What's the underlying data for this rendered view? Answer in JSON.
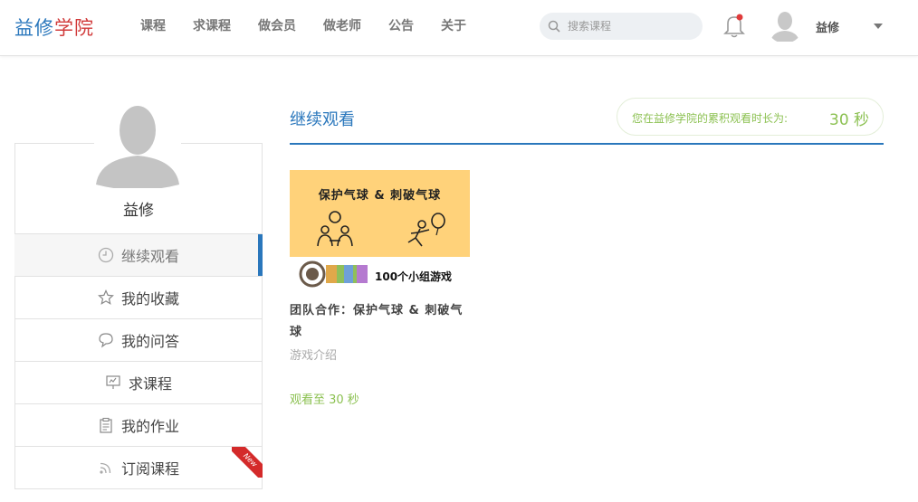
{
  "logo": {
    "part1": "益修",
    "part2": "学院"
  },
  "nav": [
    "课程",
    "求课程",
    "做会员",
    "做老师",
    "公告",
    "关于"
  ],
  "search": {
    "placeholder": "搜索课程"
  },
  "user": {
    "name": "益修"
  },
  "sidebar": {
    "profile_name": "益修",
    "items": [
      {
        "label": "继续观看",
        "icon": "clock-icon",
        "active": true
      },
      {
        "label": "我的收藏",
        "icon": "star-icon"
      },
      {
        "label": "我的问答",
        "icon": "chat-icon"
      },
      {
        "label": "求课程",
        "icon": "presentation-icon"
      },
      {
        "label": "我的作业",
        "icon": "clipboard-icon"
      },
      {
        "label": "订阅课程",
        "icon": "rss-icon",
        "badge": "New"
      }
    ]
  },
  "main": {
    "title": "继续观看",
    "watch_label": "您在益修学院的累积观看时长为:",
    "watch_value": "30 秒"
  },
  "course": {
    "thumb_title": "保护气球 & 刺破气球",
    "thumb_subtitle": "100个小组游戏",
    "name": "团队合作：保护气球 & 刺破气球",
    "category": "游戏介绍",
    "progress": "观看至 30 秒"
  },
  "colors": {
    "accent": "#2a77bc",
    "brand_red": "#d13b3b",
    "green": "#8cc152",
    "thumb_bg": "#ffd27a"
  }
}
